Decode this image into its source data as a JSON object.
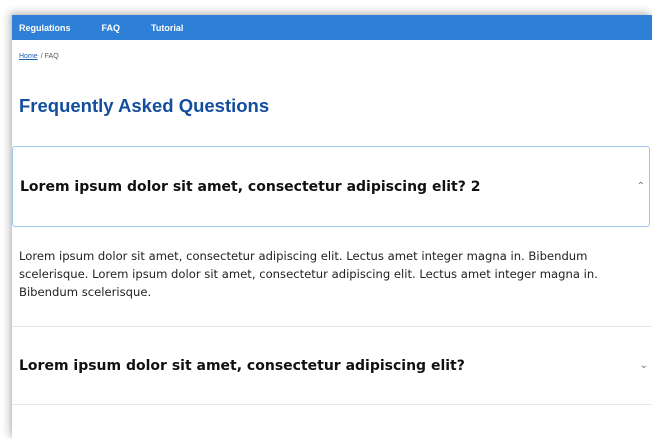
{
  "nav": {
    "items": [
      "Regulations",
      "FAQ",
      "Tutorial"
    ]
  },
  "breadcrumb": {
    "home": "Home",
    "separator": "/",
    "current": "FAQ"
  },
  "page": {
    "title": "Frequently Asked Questions"
  },
  "faq": {
    "items": [
      {
        "question": "Lorem ipsum dolor sit amet, consectetur adipiscing elit? 2",
        "expanded": true,
        "answer": "Lorem ipsum dolor sit amet, consectetur adipiscing elit. Lectus amet integer magna in. Bibendum scelerisque. Lorem ipsum dolor sit amet, consectetur adipiscing elit. Lectus amet integer magna in. Bibendum scelerisque."
      },
      {
        "question": "Lorem ipsum dolor sit amet, consectetur adipiscing elit?",
        "expanded": false
      }
    ]
  },
  "icons": {
    "expanded": "chevron-up-icon",
    "collapsed": "chevron-down-icon"
  },
  "colors": {
    "navbar": "#2e7fd6",
    "title": "#134e9e",
    "link": "#1a5fb4"
  }
}
